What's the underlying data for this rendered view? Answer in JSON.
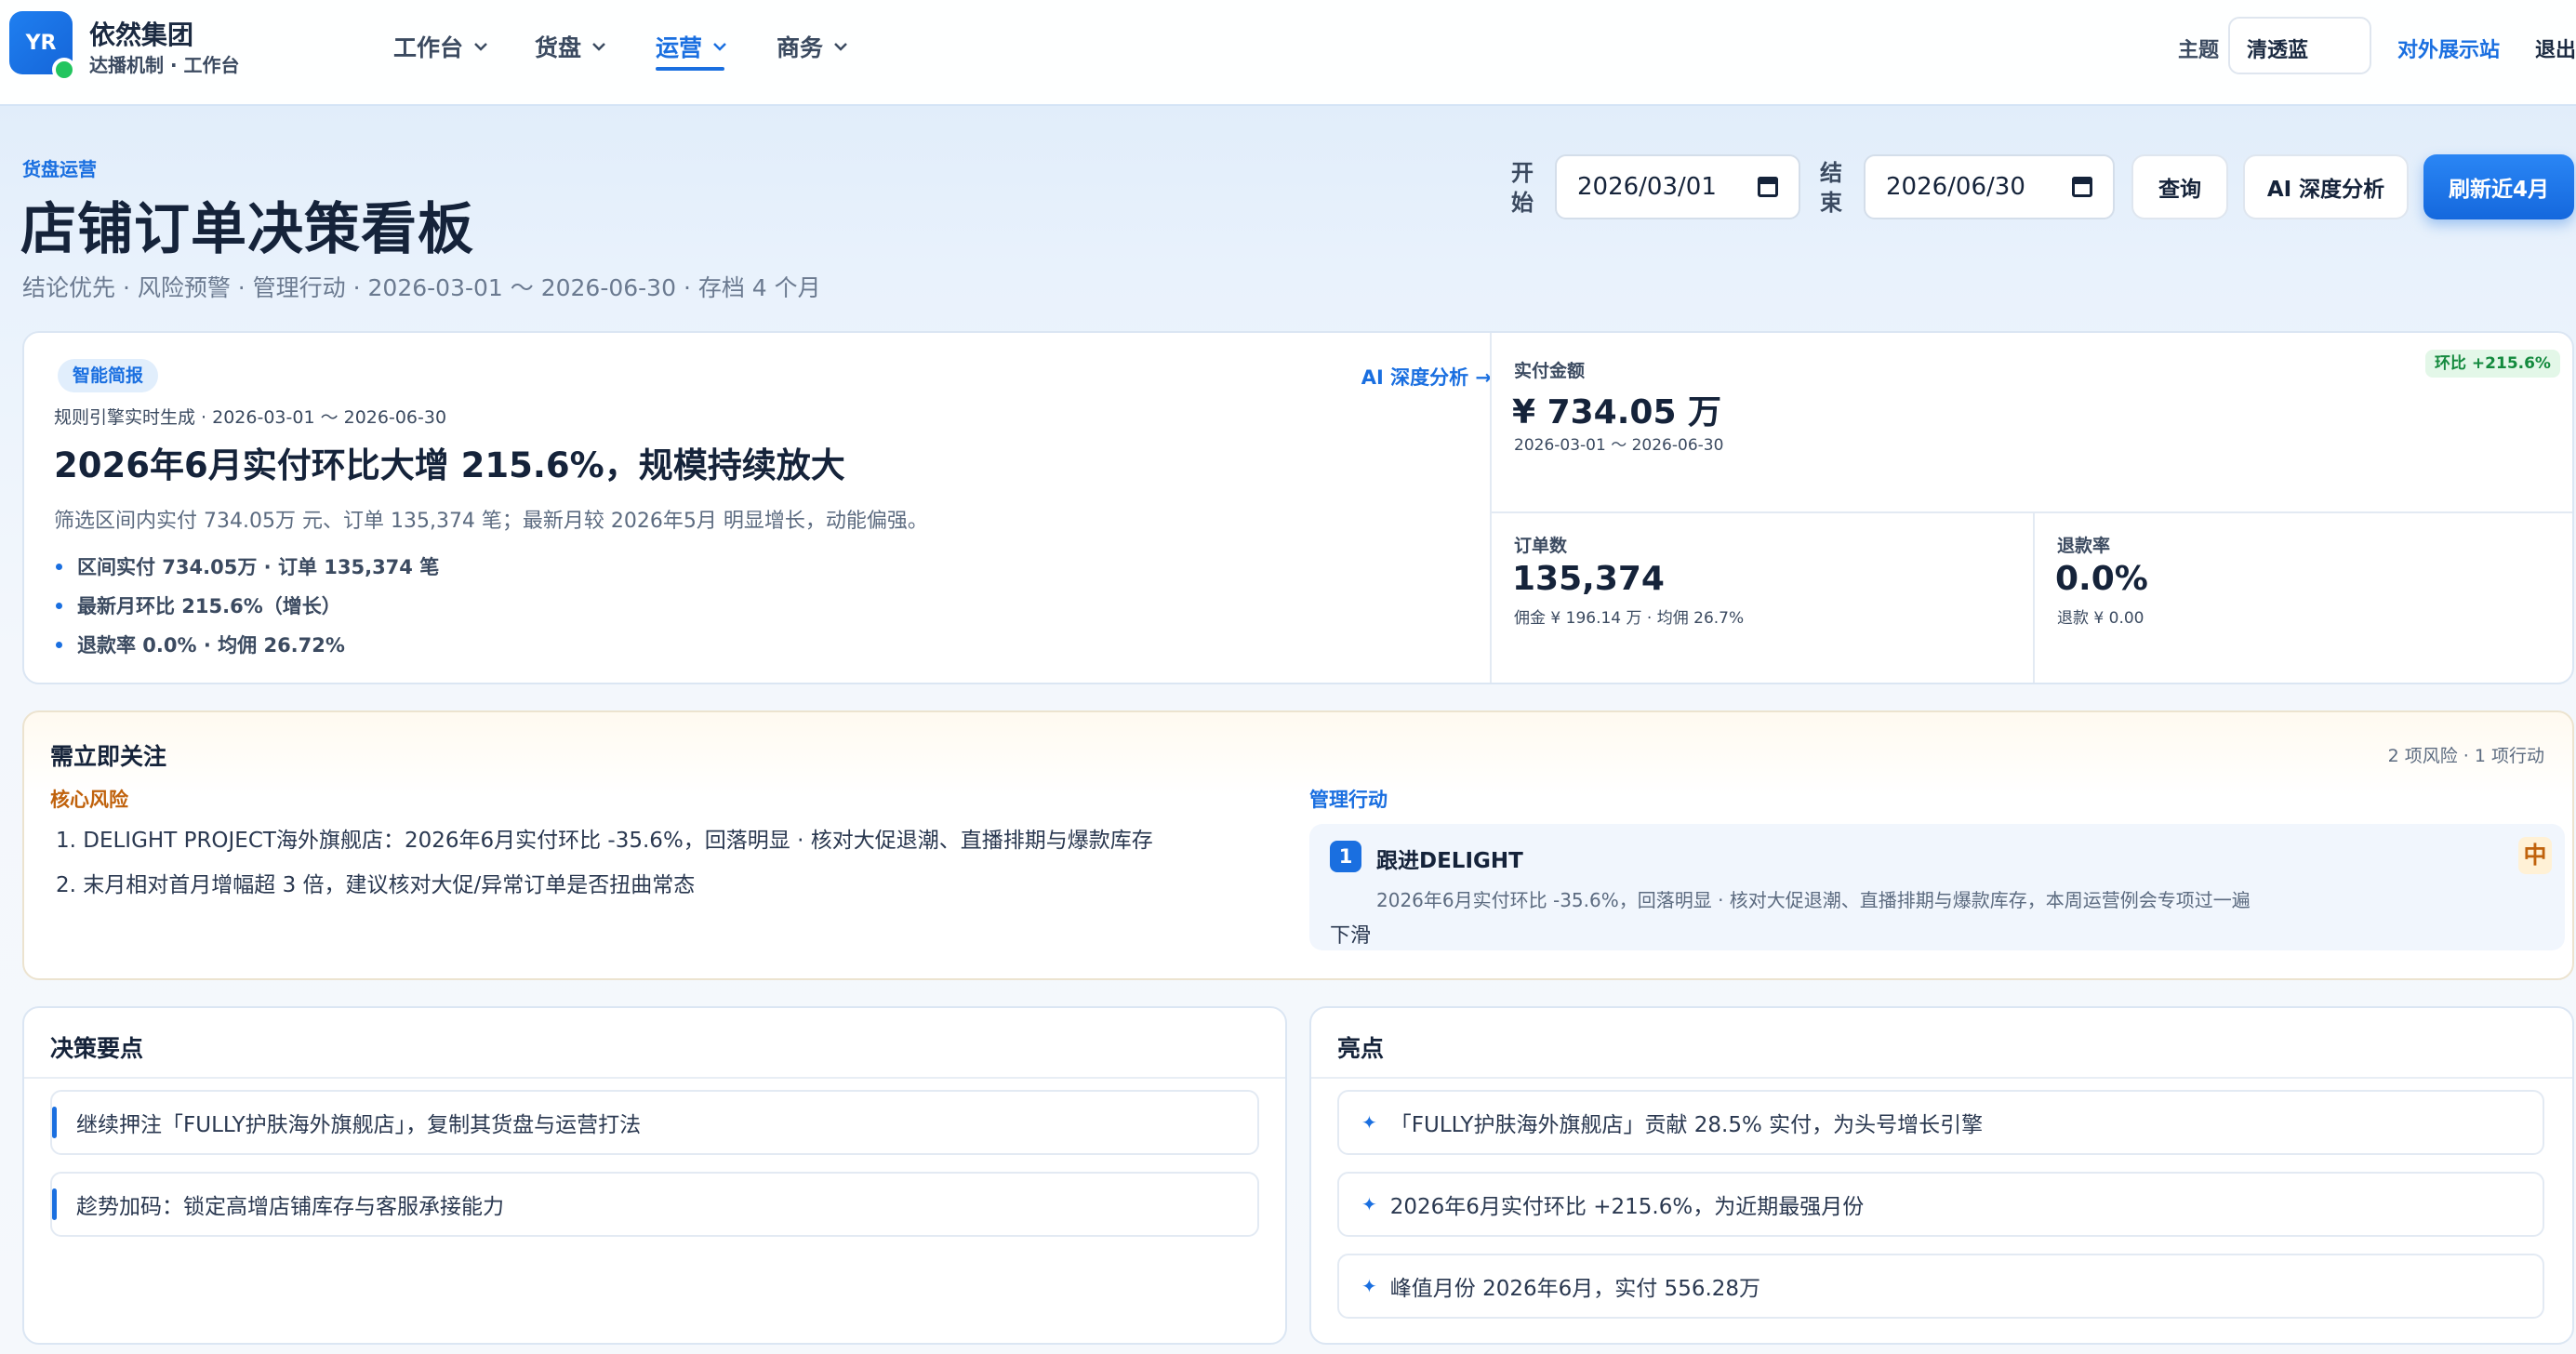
{
  "brand": {
    "logo_text": "YR",
    "name": "依然集团",
    "subtitle": "达播机制 · 工作台"
  },
  "nav": {
    "items": [
      {
        "label": "工作台"
      },
      {
        "label": "货盘"
      },
      {
        "label": "运营"
      },
      {
        "label": "商务"
      }
    ],
    "active": "运营"
  },
  "topbar": {
    "theme_label": "主题",
    "theme_value": "清透蓝",
    "showcase_link": "对外展示站",
    "logout": "退出"
  },
  "header": {
    "eyebrow": "货盘运营",
    "title": "店铺订单决策看板",
    "subtitle": "结论优先 · 风险预警 · 管理行动 · 2026-03-01 ～ 2026-06-30 · 存档 4 个月"
  },
  "filters": {
    "start_label": "开始",
    "start_value": "2026/03/01",
    "end_label": "结束",
    "end_value": "2026/06/30",
    "query_btn": "查询",
    "ai_btn": "AI 深度分析",
    "refresh_btn": "刷新近4月"
  },
  "brief": {
    "tag": "智能简报",
    "link": "AI 深度分析 →",
    "meta": "规则引擎实时生成 · 2026-03-01 ～ 2026-06-30",
    "headline": "2026年6月实付环比大增 215.6%，规模持续放大",
    "desc": "筛选区间内实付 734.05万 元、订单 135,374 笔；最新月较 2026年5月 明显增长，动能偏强。",
    "bullets": [
      "区间实付 734.05万 · 订单 135,374 笔",
      "最新月环比 215.6%（增长）",
      "退款率 0.0% · 均佣 26.72%"
    ]
  },
  "stats": {
    "paid": {
      "label": "实付金额",
      "value": "¥ 734.05 万",
      "sub": "2026-03-01 ～ 2026-06-30",
      "badge": "环比 +215.6%"
    },
    "orders": {
      "label": "订单数",
      "value": "135,374",
      "sub": "佣金 ¥ 196.14 万 · 均佣 26.7%"
    },
    "refund": {
      "label": "退款率",
      "value": "0.0%",
      "sub": "退款 ¥ 0.00"
    }
  },
  "attention": {
    "title": "需立即关注",
    "count": "2 项风险 · 1 项行动",
    "risk_heading": "核心风险",
    "risks": [
      "1. DELIGHT PROJECT海外旗舰店：2026年6月实付环比 -35.6%，回落明显 · 核对大促退潮、直播排期与爆款库存",
      "2. 末月相对首月增幅超 3 倍，建议核对大促/异常订单是否扭曲常态"
    ],
    "action_heading": "管理行动",
    "action": {
      "num": "1",
      "title": "跟进DELIGHT",
      "priority": "中",
      "desc": "2026年6月实付环比 -35.6%，回落明显 · 核对大促退潮、直播排期与爆款库存，本周运营例会专项过一遍",
      "desc2": "下滑"
    }
  },
  "decisions": {
    "title": "决策要点",
    "items": [
      "继续押注「FULLY护肤海外旗舰店」，复制其货盘与运营打法",
      "趁势加码：锁定高增店铺库存与客服承接能力"
    ]
  },
  "highlights": {
    "title": "亮点",
    "items": [
      "「FULLY护肤海外旗舰店」贡献 28.5% 实付，为头号增长引擎",
      "2026年6月实付环比 +215.6%，为近期最强月份",
      "峰值月份 2026年6月，实付 556.28万"
    ]
  },
  "colors": {
    "accent": "#1a6fe0",
    "risk": "#c0620c",
    "positive": "#148a3e"
  }
}
